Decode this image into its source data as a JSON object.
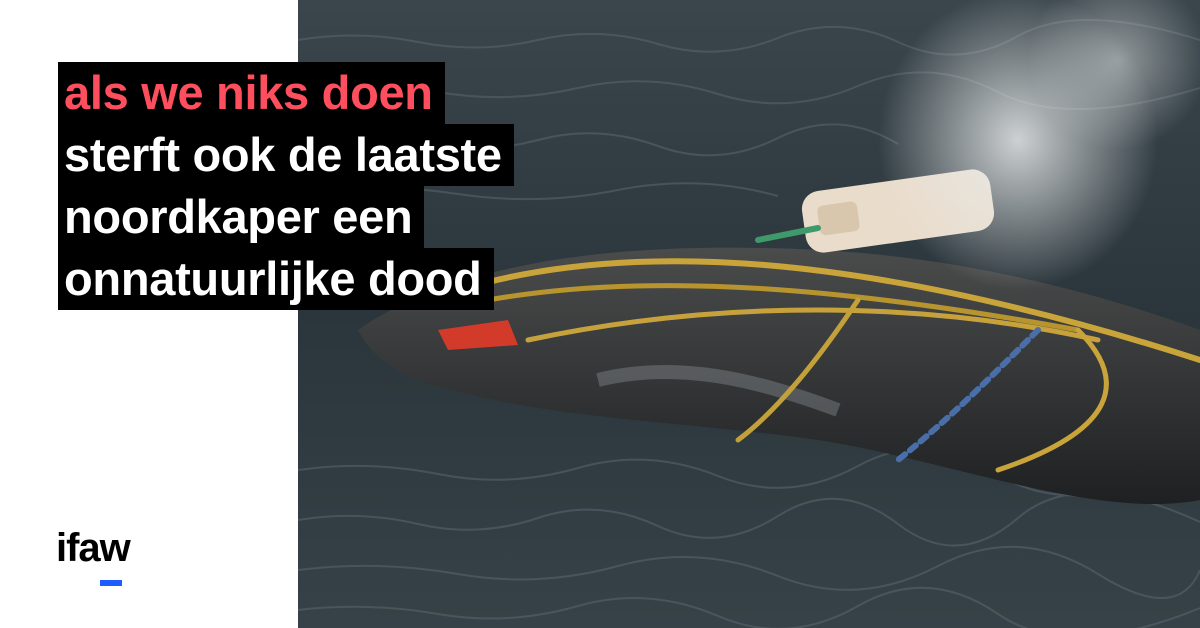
{
  "headline": {
    "lines": [
      "als we niks doen",
      "sterft ook de laatste",
      "noordkaper een",
      "onnatuurlijke dood"
    ]
  },
  "brand": {
    "logo_text": "ifaw",
    "accent_color": "#1e5cff"
  },
  "colors": {
    "highlight_text": "#ff4f5e",
    "text_box": "#000000",
    "text": "#ffffff"
  },
  "photo": {
    "icon": "entangled-whale-photo"
  }
}
